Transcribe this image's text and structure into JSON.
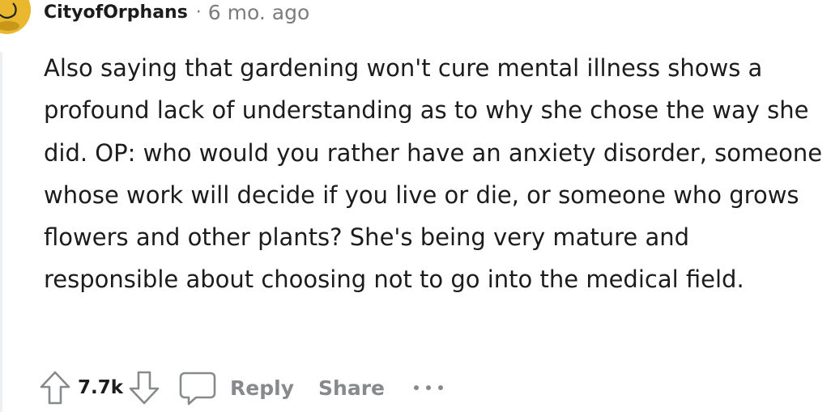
{
  "comment": {
    "author": "CityofOrphans",
    "separator": "·",
    "timestamp": "6 mo. ago",
    "body": "Also saying that gardening won't cure mental illness shows a profound lack of understanding as to why she chose the way she did. OP: who would you rather have an anxiety disorder, someone whose work will decide if you live or die, or someone who grows flowers and other plants? She's being very mature and responsible about choosing not to go into the medical field."
  },
  "actions": {
    "upvote_icon": "arrow-up-icon",
    "vote_count": "7.7k",
    "downvote_icon": "arrow-down-icon",
    "reply_icon": "speech-bubble-icon",
    "reply_label": "Reply",
    "share_label": "Share",
    "more_icon": "ellipsis-icon"
  },
  "colors": {
    "text": "#1c1c1c",
    "muted": "#7c7c7c",
    "action_gray": "#878a8c",
    "avatar": "#e9b82f",
    "thread_line": "#edeff1"
  }
}
